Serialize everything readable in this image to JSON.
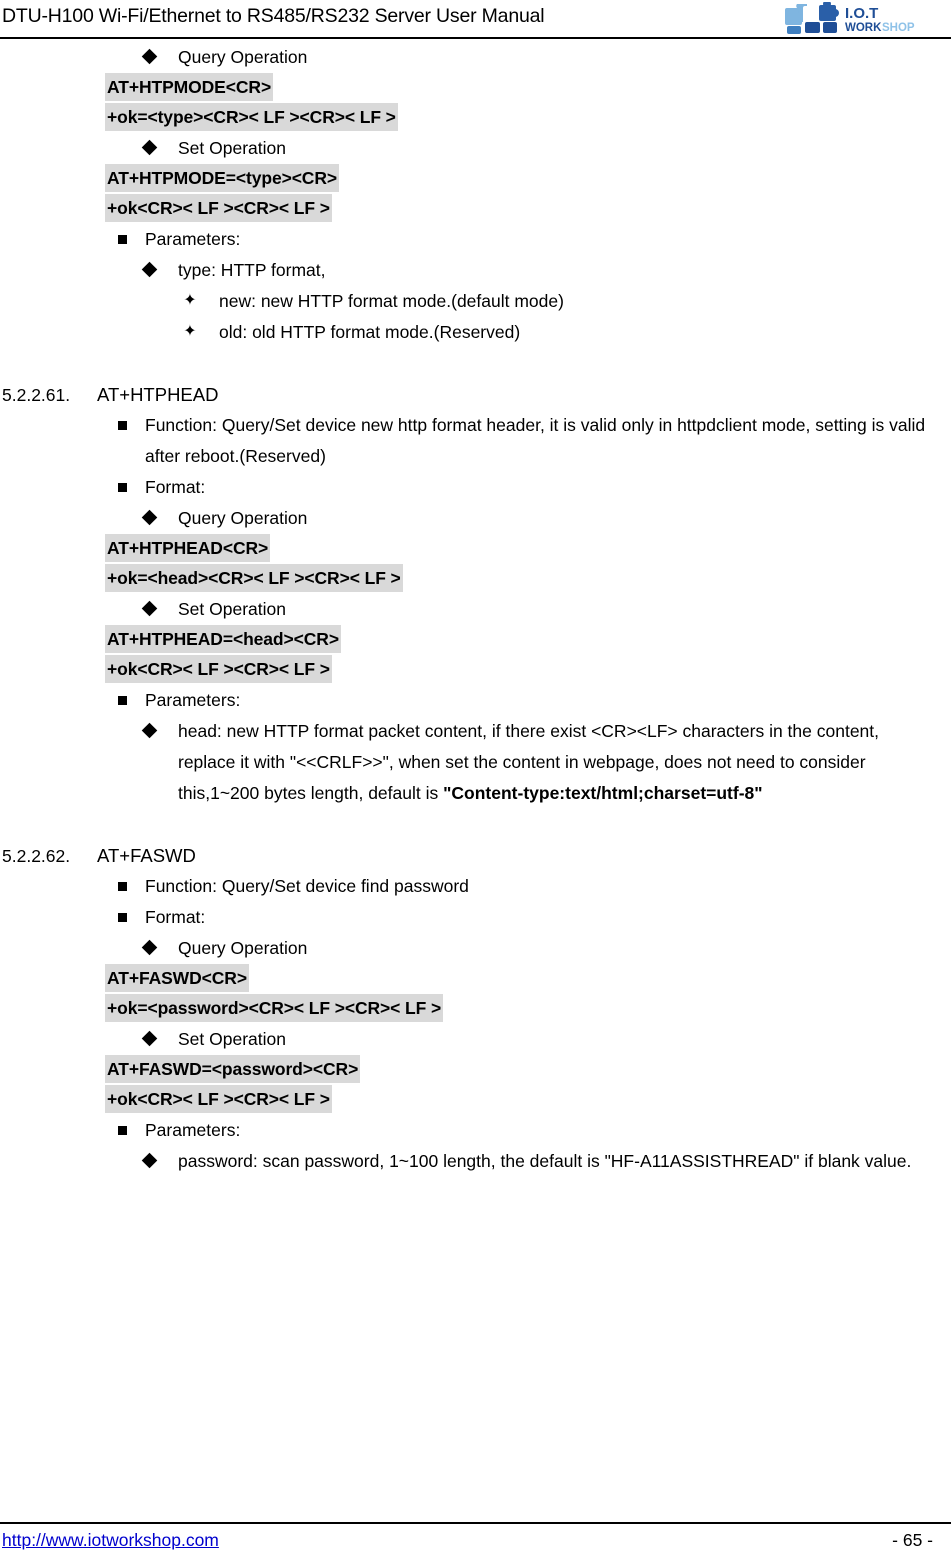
{
  "header": {
    "title": "DTU-H100  Wi-Fi/Ethernet to RS485/RS232  Server User Manual",
    "logo_primary": "I.O.T",
    "logo_secondary_dark": "WORK",
    "logo_secondary_light": "SHOP",
    "logo_colors": {
      "light_blue": "#7fb5e0",
      "mid_blue": "#4a90c8",
      "dark_blue": "#1f4e96"
    }
  },
  "footer": {
    "url": "http://www.iotworkshop.com",
    "page_number": "- 65 -"
  },
  "body": {
    "htpmode_tail": {
      "query_label": "Query Operation",
      "query_cmd": "AT+HTPMODE<CR>",
      "query_resp": "+ok=<type><CR>< LF ><CR>< LF >",
      "set_label": "Set Operation",
      "set_cmd": "AT+HTPMODE=<type><CR>",
      "set_resp": "+ok<CR>< LF ><CR>< LF >",
      "parameters_label": "Parameters:",
      "param_type": "type: HTTP format,",
      "opt_new": "new: new HTTP format mode.(default mode)",
      "opt_old": "old: old HTTP format mode.(Reserved)"
    },
    "htphead": {
      "section_number": "5.2.2.61.",
      "section_title": "AT+HTPHEAD",
      "function": "Function: Query/Set device new http format header, it is valid only in httpdclient mode, setting is valid after reboot.(Reserved)",
      "format_label": "Format:",
      "query_label": "Query Operation",
      "query_cmd": "AT+HTPHEAD<CR>",
      "query_resp": "+ok=<head><CR>< LF ><CR>< LF >",
      "set_label": "Set Operation",
      "set_cmd": "AT+HTPHEAD=<head><CR>",
      "set_resp": "+ok<CR>< LF ><CR>< LF >",
      "parameters_label": "Parameters:",
      "param_head_text": "head: new HTTP format packet content, if there exist <CR><LF> characters in the content, replace it with \"<<CRLF>>\", when set the content in webpage, does not need to consider this,1~200 bytes length, default is ",
      "param_head_bold": "\"Content-type:text/html;charset=utf-8\""
    },
    "faswd": {
      "section_number": "5.2.2.62.",
      "section_title": "AT+FASWD",
      "function": "Function: Query/Set device find password",
      "format_label": "Format:",
      "query_label": "Query Operation",
      "query_cmd": "AT+FASWD<CR>",
      "query_resp": "+ok=<password><CR>< LF ><CR>< LF >",
      "set_label": "Set Operation",
      "set_cmd": "AT+FASWD=<password><CR>",
      "set_resp": "+ok<CR>< LF ><CR>< LF >",
      "parameters_label": "Parameters:",
      "param_password": "password: scan password, 1~100 length, the default is \"HF-A11ASSISTHREAD\" if blank value."
    }
  },
  "icons": {
    "bullet_square": "filled-square-bullet",
    "bullet_diamond": "filled-diamond-bullet",
    "bullet_hollow_diamond": "hollow-diamond-bullet"
  }
}
